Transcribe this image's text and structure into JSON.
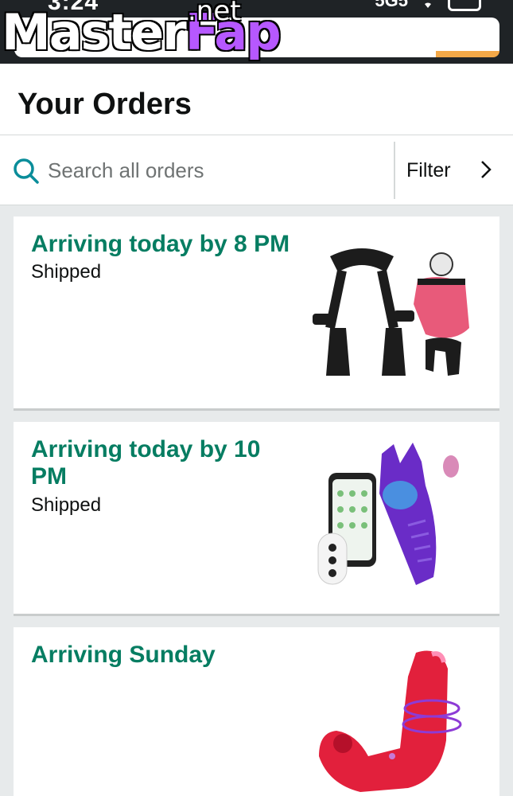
{
  "status_bar": {
    "time": "3:24",
    "signal": "5G5",
    "wifi_icon": "wifi-icon",
    "battery_icon": "battery-icon"
  },
  "browser": {
    "url": "amazon.com"
  },
  "watermark": {
    "part1": "Master",
    "part2": "Fap",
    "suffix": ".net"
  },
  "page": {
    "title": "Your Orders"
  },
  "search": {
    "placeholder": "Search all orders",
    "icon": "search-icon"
  },
  "filter": {
    "label": "Filter",
    "icon": "chevron-right-icon"
  },
  "orders": [
    {
      "status": "Arriving today by 8 PM",
      "substatus": "Shipped",
      "image": "restraint-swing-product-image"
    },
    {
      "status": "Arriving today by 10 PM",
      "substatus": "Shipped",
      "image": "app-controlled-toy-product-image"
    },
    {
      "status": "Arriving Sunday",
      "substatus": "",
      "image": "red-vibrator-product-image"
    }
  ],
  "colors": {
    "status_green": "#067d62",
    "accent_orange": "#f3a847",
    "watermark_purple": "#b658ff"
  }
}
